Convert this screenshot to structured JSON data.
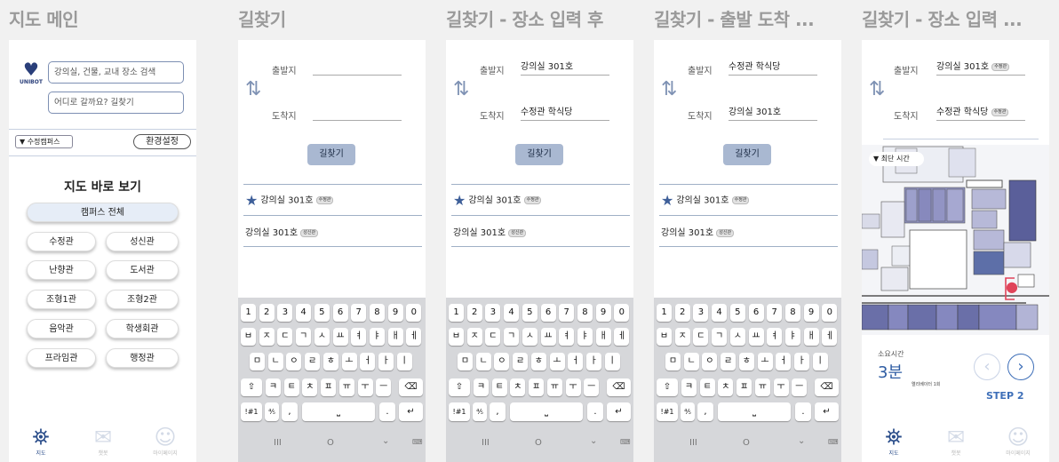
{
  "frames": [
    {
      "title": "지도 메인"
    },
    {
      "title": "길찾기"
    },
    {
      "title": "길찾기 - 장소 입력 후"
    },
    {
      "title": "길찾기 - 출발 도착 ..."
    },
    {
      "title": "길찾기 - 장소 입력 ..."
    }
  ],
  "main": {
    "logo_text": "UNIBOT",
    "search_placeholder": "강의실, 건물, 교내 장소 검색",
    "route_placeholder": "어디로 갈까요? 길찾기",
    "campus_select": "▼ 수정캠퍼스",
    "settings_label": "환경설정",
    "map_title": "지도 바로 보기",
    "campus_all": "캠퍼스 전체",
    "buildings": [
      "수정관",
      "성신관",
      "난향관",
      "도서관",
      "조형1관",
      "조형2관",
      "음악관",
      "학생회관",
      "프라임관",
      "행정관"
    ],
    "nav": [
      {
        "label": "지도",
        "icon": "map-pin-icon"
      },
      {
        "label": "챗봇",
        "icon": "chat-icon"
      },
      {
        "label": "마이페이지",
        "icon": "user-icon"
      }
    ]
  },
  "route": {
    "start_label": "출발지",
    "end_label": "도착지",
    "search_button": "길찾기",
    "frame2": {
      "start": "",
      "end": ""
    },
    "frame3": {
      "start": "강의실 301호",
      "end": "수정관 학식당"
    },
    "frame4": {
      "start": "수정관 학식당",
      "end": "강의실 301호"
    },
    "frame5": {
      "start": "강의실 301호",
      "end": "수정관 학식당",
      "start_tag": "수정관",
      "end_tag": "수정관"
    },
    "results": [
      {
        "name": "강의실 301호",
        "tag": "수정관",
        "starred": true
      },
      {
        "name": "강의실 301호",
        "tag": "성신관",
        "starred": false
      }
    ]
  },
  "keyboard": {
    "row1": [
      "1",
      "2",
      "3",
      "4",
      "5",
      "6",
      "7",
      "8",
      "9",
      "0"
    ],
    "row2": [
      "ㅂ",
      "ㅈ",
      "ㄷ",
      "ㄱ",
      "ㅅ",
      "ㅛ",
      "ㅕ",
      "ㅑ",
      "ㅐ",
      "ㅔ"
    ],
    "row3": [
      "ㅁ",
      "ㄴ",
      "ㅇ",
      "ㄹ",
      "ㅎ",
      "ㅗ",
      "ㅓ",
      "ㅏ",
      "ㅣ"
    ],
    "row4": [
      "ㅋ",
      "ㅌ",
      "ㅊ",
      "ㅍ",
      "ㅠ",
      "ㅜ",
      "ㅡ"
    ],
    "shift": "⇧",
    "backspace": "⌫",
    "symbols": "!#1",
    "fraction": "⅘",
    "comma": ",",
    "space": "⎵",
    "period": ".",
    "enter": "↵",
    "nav_recent": "III",
    "nav_home": "O",
    "nav_hide": "⌄",
    "nav_kb": "⌨"
  },
  "result": {
    "badge": "▼ 최단 시간",
    "time_label": "소요시간",
    "time_value": "3분",
    "elevator": "엘리베이터 1회",
    "step": "STEP 2",
    "prev_icon": "chevron-left-icon",
    "next_icon": "chevron-right-icon"
  },
  "colors": {
    "accent": "#2a4d8a",
    "button": "#a9b8d1",
    "route_line": "#e0445a",
    "room_dark": "#6a6fa8",
    "room_light": "#b2b4d6"
  }
}
